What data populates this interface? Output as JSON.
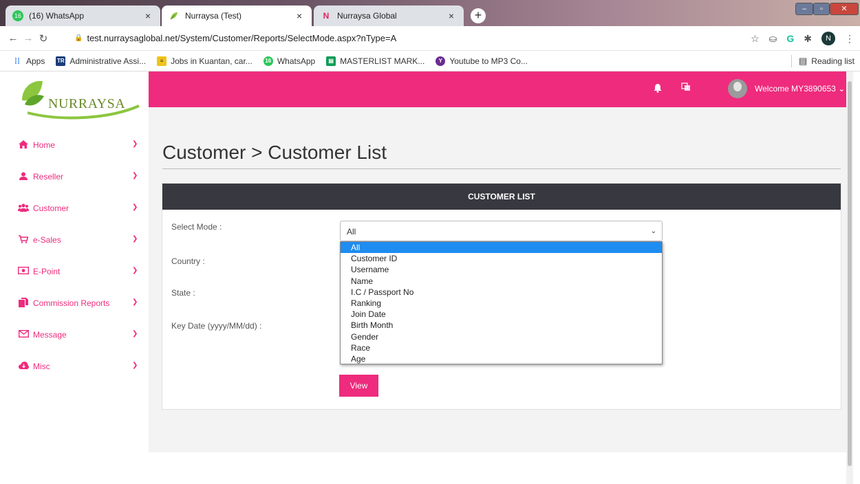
{
  "browser": {
    "tabs": [
      {
        "title": "(16) WhatsApp",
        "badge": "16",
        "icon": "whatsapp-icon",
        "active": false
      },
      {
        "title": "Nurraysa (Test)",
        "icon": "leaf-icon",
        "active": true
      },
      {
        "title": "Nurraysa Global",
        "icon": "n-logo-icon",
        "active": false
      }
    ],
    "close_glyph": "×",
    "new_tab_glyph": "+",
    "url": "test.nurraysaglobal.net/System/Customer/Reports/SelectMode.aspx?nType=A",
    "profile_initial": "N",
    "bookmarks": [
      {
        "label": "Apps",
        "icon": "apps-grid-icon"
      },
      {
        "label": "Administrative Assi...",
        "icon_text": "TR"
      },
      {
        "label": "Jobs in Kuantan, car...",
        "icon": "jobs-icon"
      },
      {
        "label": "WhatsApp",
        "icon_text": "16"
      },
      {
        "label": "MASTERLIST MARK...",
        "icon": "sheets-icon"
      },
      {
        "label": "Youtube to MP3 Co...",
        "icon": "youtube-mp3-icon"
      }
    ],
    "reading_list": "Reading list"
  },
  "brand": {
    "logo_text": "NURRAYSA",
    "accent": "#ee2b7d",
    "header_dark": "#383840"
  },
  "topbar": {
    "welcome": "Welcome MY3890653"
  },
  "sidebar": {
    "items": [
      {
        "label": "Home",
        "icon": "home-icon"
      },
      {
        "label": "Reseller",
        "icon": "user-icon"
      },
      {
        "label": "Customer",
        "icon": "users-icon"
      },
      {
        "label": "e-Sales",
        "icon": "cart-icon"
      },
      {
        "label": "E-Point",
        "icon": "money-icon"
      },
      {
        "label": "Commission Reports",
        "icon": "copy-icon"
      },
      {
        "label": "Message",
        "icon": "envelope-icon"
      },
      {
        "label": "Misc",
        "icon": "cloud-icon"
      }
    ]
  },
  "main": {
    "title": "Customer > Customer List",
    "card_title": "CUSTOMER LIST",
    "form": {
      "select_mode_label": "Select Mode :",
      "country_label": "Country :",
      "state_label": "State :",
      "key_date_label": "Key Date (yyyy/MM/dd) :",
      "select_mode_value": "All",
      "view_button": "View"
    },
    "dropdown_options": [
      "All",
      "Customer ID",
      "Username",
      "Name",
      "I.C / Passport No",
      "Ranking",
      "Join Date",
      "Birth Month",
      "Gender",
      "Race",
      "Age"
    ],
    "dropdown_selected_index": 0
  }
}
